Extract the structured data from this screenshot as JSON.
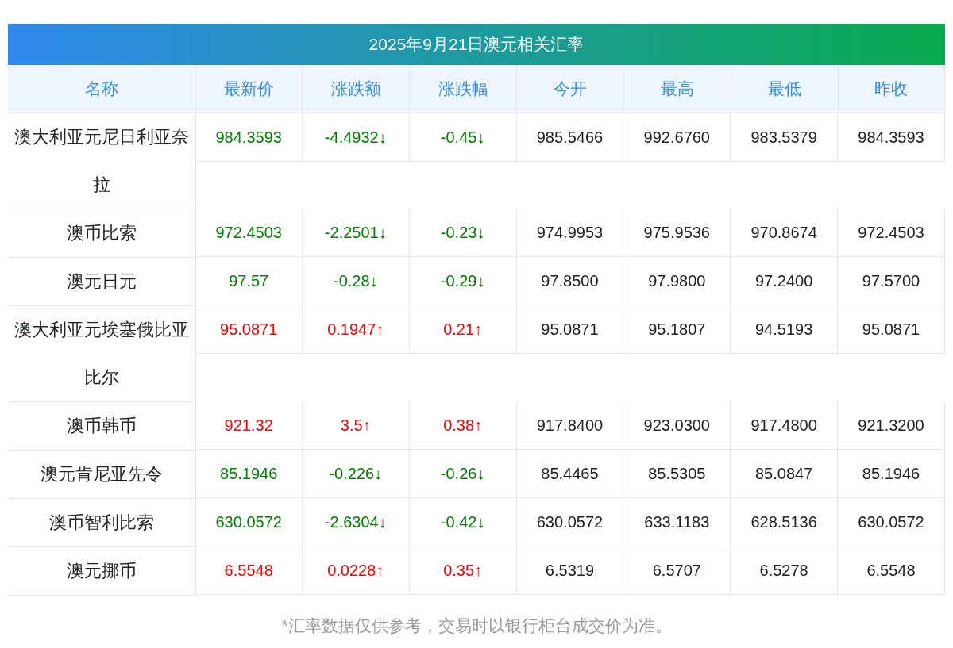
{
  "title": "2025年9月21日澳元相关汇率",
  "table": {
    "columns": [
      "名称",
      "最新价",
      "涨跌额",
      "涨跌幅",
      "今开",
      "最高",
      "最低",
      "昨收"
    ],
    "rows": [
      {
        "color": "#008000",
        "cells": [
          "澳大利亚元尼日利亚奈拉",
          "984.3593",
          "-4.4932↓",
          "-0.45↓",
          "985.5466",
          "992.6760",
          "983.5379",
          "984.3593"
        ]
      },
      {
        "color": "#008000",
        "cells": [
          "澳币比索",
          "972.4503",
          "-2.2501↓",
          "-0.23↓",
          "974.9953",
          "975.9536",
          "970.8674",
          "972.4503"
        ]
      },
      {
        "color": "#008000",
        "cells": [
          "澳元日元",
          "97.57",
          "-0.28↓",
          "-0.29↓",
          "97.8500",
          "97.9800",
          "97.2400",
          "97.5700"
        ]
      },
      {
        "color": "#ff0000",
        "cells": [
          "澳大利亚元埃塞俄比亚比尔",
          "95.0871",
          "0.1947↑",
          "0.21↑",
          "95.0871",
          "95.1807",
          "94.5193",
          "95.0871"
        ]
      },
      {
        "color": "#ff0000",
        "cells": [
          "澳币韩币",
          "921.32",
          "3.5↑",
          "0.38↑",
          "917.8400",
          "923.0300",
          "917.4800",
          "921.3200"
        ]
      },
      {
        "color": "#008000",
        "cells": [
          "澳元肯尼亚先令",
          "85.1946",
          "-0.226↓",
          "-0.26↓",
          "85.4465",
          "85.5305",
          "85.0847",
          "85.1946"
        ]
      },
      {
        "color": "#008000",
        "cells": [
          "澳币智利比索",
          "630.0572",
          "-2.6304↓",
          "-0.42↓",
          "630.0572",
          "633.1183",
          "628.5136",
          "630.0572"
        ]
      },
      {
        "color": "#ff0000",
        "cells": [
          "澳元挪币",
          "6.5548",
          "0.0228↑",
          "0.35↑",
          "6.5319",
          "6.5707",
          "6.5278",
          "6.5548"
        ]
      }
    ]
  },
  "footnote": "*汇率数据仅供参考，交易时以银行柜台成交价为准。"
}
